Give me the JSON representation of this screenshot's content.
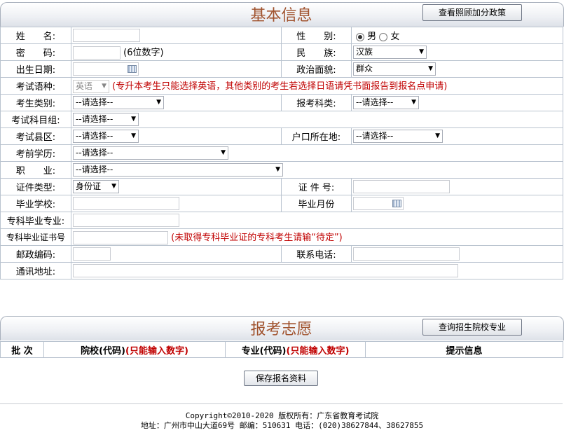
{
  "basic": {
    "title": "基本信息",
    "policy_button": "查看照顾加分政策",
    "name_label": "姓　　名:",
    "gender_label": "性　　别:",
    "gender_male": "男",
    "gender_female": "女",
    "password_label": "密　　码:",
    "password_hint": "(6位数字)",
    "ethnicity_label": "民　　族:",
    "ethnicity_value": "汉族",
    "birth_label": "出生日期:",
    "political_label": "政治面貌:",
    "political_value": "群众",
    "language_label": "考试语种:",
    "language_value": "英语",
    "language_note": "(专升本考生只能选择英语，其他类别的考生若选择日语请凭书面报告到报名点申请)",
    "category_label": "考生类别:",
    "subject_label": "报考科类:",
    "group_label": "考试科目组:",
    "county_label": "考试县区:",
    "hukou_label": "户口所在地:",
    "education_label": "考前学历:",
    "job_label": "职　　业:",
    "placeholder": "--请选择--",
    "idtype_label": "证件类型:",
    "idtype_value": "身份证",
    "idno_label": "证 件 号:",
    "school_label": "毕业学校:",
    "gradmonth_label": "毕业月份",
    "major_label": "专科毕业专业:",
    "cert_label": "专科毕业证书号",
    "cert_note": "(未取得专科毕业证的专科考生请输“待定”)",
    "zip_label": "邮政编码:",
    "phone_label": "联系电话:",
    "address_label": "通讯地址:"
  },
  "wish": {
    "title": "报考志愿",
    "query_button": "查询招生院校专业",
    "col_batch": "批 次",
    "col_school": "院校(代码)",
    "col_school_note": "(只能输入数字)",
    "col_major": "专业(代码)",
    "col_major_note": "(只能输入数字)",
    "col_tip": "提示信息"
  },
  "save_button": "保存报名资料",
  "footer": {
    "copyright": "Copyright©2010-2020 版权所有：广东省教育考试院",
    "address": "地址：广州市中山大道69号 邮编：510631 电话：(020)38627844、38627855"
  },
  "colors": {
    "title": "#a0522d",
    "note": "#c00000",
    "border": "#b9c3cf"
  }
}
